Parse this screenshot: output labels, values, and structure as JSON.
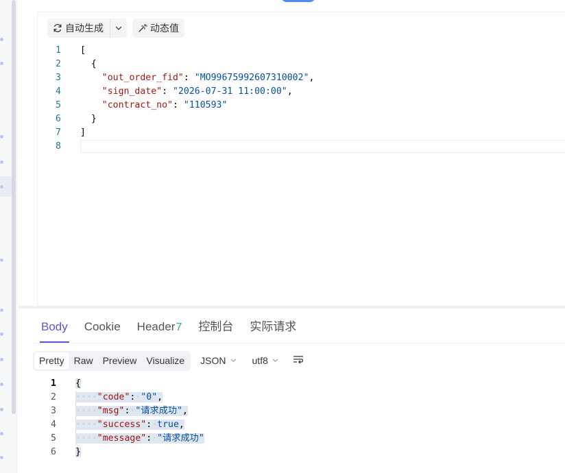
{
  "toolbar": {
    "auto_generate_label": "自动生成",
    "dynamic_value_label": "动态值"
  },
  "request_body": {
    "lines": [
      {
        "num": "1",
        "tokens": [
          {
            "t": "[",
            "c": "punc"
          }
        ]
      },
      {
        "num": "2",
        "tokens": [
          {
            "t": "  {",
            "c": "punc"
          }
        ]
      },
      {
        "num": "3",
        "tokens": [
          {
            "t": "    ",
            "c": "punc"
          },
          {
            "t": "\"out_order_fid\"",
            "c": "key"
          },
          {
            "t": ": ",
            "c": "punc"
          },
          {
            "t": "\"MO99675992607310002\"",
            "c": "str"
          },
          {
            "t": ",",
            "c": "punc"
          }
        ]
      },
      {
        "num": "4",
        "tokens": [
          {
            "t": "    ",
            "c": "punc"
          },
          {
            "t": "\"sign_date\"",
            "c": "key"
          },
          {
            "t": ": ",
            "c": "punc"
          },
          {
            "t": "\"2026-07-31 11:00:00\"",
            "c": "str"
          },
          {
            "t": ",",
            "c": "punc"
          }
        ]
      },
      {
        "num": "5",
        "tokens": [
          {
            "t": "    ",
            "c": "punc"
          },
          {
            "t": "\"contract_no\"",
            "c": "key"
          },
          {
            "t": ": ",
            "c": "punc"
          },
          {
            "t": "\"110593\"",
            "c": "str"
          }
        ]
      },
      {
        "num": "6",
        "tokens": [
          {
            "t": "  }",
            "c": "punc"
          }
        ]
      },
      {
        "num": "7",
        "tokens": [
          {
            "t": "]",
            "c": "punc"
          }
        ]
      },
      {
        "num": "8",
        "tokens": []
      }
    ]
  },
  "response": {
    "tabs": [
      {
        "label": "Body",
        "active": true
      },
      {
        "label": "Cookie"
      },
      {
        "label": "Header",
        "badge": "7"
      },
      {
        "label": "控制台"
      },
      {
        "label": "实际请求"
      }
    ],
    "view_modes": [
      {
        "label": "Pretty",
        "active": true
      },
      {
        "label": "Raw"
      },
      {
        "label": "Preview"
      },
      {
        "label": "Visualize"
      }
    ],
    "format": "JSON",
    "encoding": "utf8",
    "lines": [
      {
        "num": "1",
        "tokens": [
          {
            "t": "{",
            "c": "punc"
          }
        ]
      },
      {
        "num": "2",
        "tokens": [
          {
            "t": "····",
            "c": "ws"
          },
          {
            "t": "\"code\"",
            "c": "key"
          },
          {
            "t": ":",
            "c": "punc"
          },
          {
            "t": "·",
            "c": "ws"
          },
          {
            "t": "\"0\"",
            "c": "str"
          },
          {
            "t": ",",
            "c": "punc"
          }
        ]
      },
      {
        "num": "3",
        "tokens": [
          {
            "t": "····",
            "c": "ws"
          },
          {
            "t": "\"msg\"",
            "c": "key"
          },
          {
            "t": ":",
            "c": "punc"
          },
          {
            "t": "·",
            "c": "ws"
          },
          {
            "t": "\"请求成功\"",
            "c": "str"
          },
          {
            "t": ",",
            "c": "punc"
          }
        ]
      },
      {
        "num": "4",
        "tokens": [
          {
            "t": "····",
            "c": "ws"
          },
          {
            "t": "\"success\"",
            "c": "key"
          },
          {
            "t": ":",
            "c": "punc"
          },
          {
            "t": "·",
            "c": "ws"
          },
          {
            "t": "true",
            "c": "bool"
          },
          {
            "t": ",",
            "c": "punc"
          }
        ]
      },
      {
        "num": "5",
        "tokens": [
          {
            "t": "····",
            "c": "ws"
          },
          {
            "t": "\"message\"",
            "c": "key"
          },
          {
            "t": ":",
            "c": "punc"
          },
          {
            "t": "·",
            "c": "ws"
          },
          {
            "t": "\"请求成功\"",
            "c": "str"
          }
        ]
      },
      {
        "num": "6",
        "tokens": [
          {
            "t": "}",
            "c": "punc"
          }
        ]
      }
    ]
  },
  "colors": {
    "accent": "#5b55d6",
    "badge": "#22b371",
    "json_key": "#a31515",
    "json_string": "#0451a5",
    "line_number": "#237893"
  }
}
